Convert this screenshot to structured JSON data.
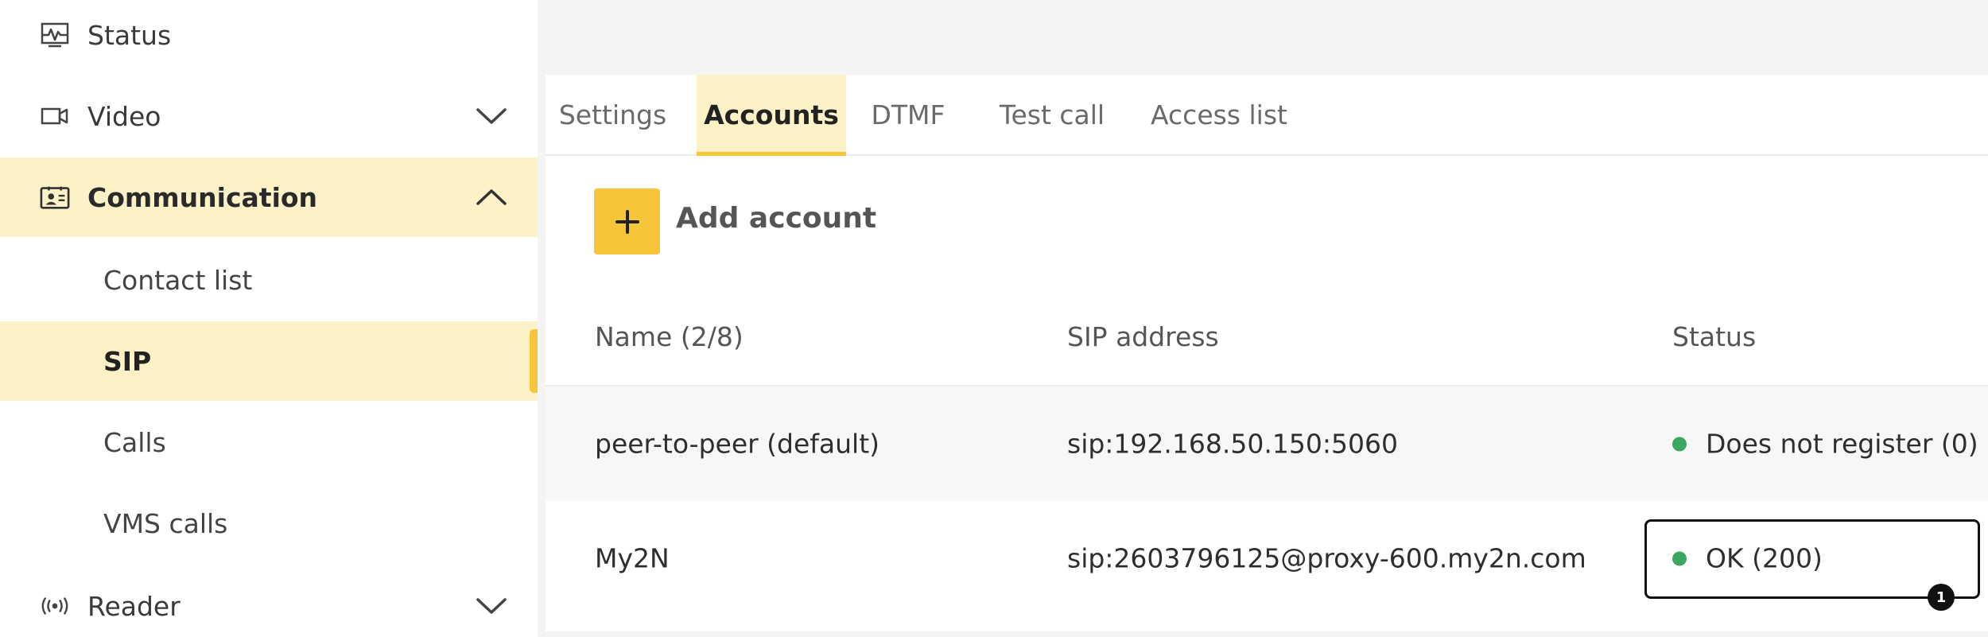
{
  "sidebar": {
    "items": [
      {
        "label": "Status",
        "icon": "activity-icon"
      },
      {
        "label": "Video",
        "icon": "camera-icon"
      },
      {
        "label": "Communication",
        "icon": "contact-card-icon"
      },
      {
        "label": "Reader",
        "icon": "wireless-reader-icon"
      }
    ],
    "sub_items": [
      {
        "label": "Contact list"
      },
      {
        "label": "SIP"
      },
      {
        "label": "Calls"
      },
      {
        "label": "VMS calls"
      }
    ],
    "selected_sub_item": "SIP"
  },
  "tabs": [
    {
      "label": "Settings"
    },
    {
      "label": "Accounts"
    },
    {
      "label": "DTMF"
    },
    {
      "label": "Test call"
    },
    {
      "label": "Access list"
    }
  ],
  "active_tab": "Accounts",
  "toolbar": {
    "add_label": "Add account"
  },
  "table": {
    "headers": {
      "name": "Name (2/8)",
      "sip_address": "SIP address",
      "status": "Status"
    },
    "rows": [
      {
        "name": "peer-to-peer (default)",
        "sip_address": "sip:192.168.50.150:5060",
        "status": "Does not register (0)",
        "status_color": "#3aa860"
      },
      {
        "name": "My2N",
        "sip_address": "sip:2603796125@proxy-600.my2n.com",
        "status": "OK (200)",
        "status_color": "#3aa860"
      }
    ]
  },
  "annotation": {
    "badge_number": "1"
  },
  "colors": {
    "accent": "#f6c53a",
    "active_background": "#fdf1c8",
    "status_green": "#3aa860"
  }
}
